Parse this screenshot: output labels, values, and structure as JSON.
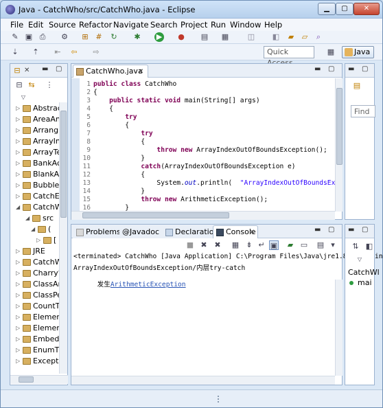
{
  "window": {
    "title": "Java - CatchWho/src/CatchWho.java - Eclipse"
  },
  "menu": [
    "File",
    "Edit",
    "Source",
    "Refactor",
    "Navigate",
    "Search",
    "Project",
    "Run",
    "Window",
    "Help"
  ],
  "toolbar": {
    "quick_access_placeholder": "Quick Access",
    "perspective_label": "Java"
  },
  "package_explorer": {
    "items": [
      {
        "label": "Abstrac",
        "arrow": "▷"
      },
      {
        "label": "AreaAn",
        "arrow": "▷"
      },
      {
        "label": "Arrang",
        "arrow": "▷"
      },
      {
        "label": "ArrayIn",
        "arrow": "▷"
      },
      {
        "label": "ArrayTe",
        "arrow": "▷"
      },
      {
        "label": "BankAc",
        "arrow": "▷"
      },
      {
        "label": "BlankA",
        "arrow": "▷"
      },
      {
        "label": "Bubble",
        "arrow": "▷"
      },
      {
        "label": "CatchE:",
        "arrow": "▷"
      },
      {
        "label": "CatchW",
        "arrow": "◢"
      },
      {
        "label": "src",
        "arrow": "◢"
      },
      {
        "label": "(",
        "arrow": "◢"
      },
      {
        "label": "[",
        "arrow": "▷"
      },
      {
        "label": "JRE",
        "arrow": "▷"
      },
      {
        "label": "CatchW",
        "arrow": "▷"
      },
      {
        "label": "Charry'",
        "arrow": "▷"
      },
      {
        "label": "ClassAr",
        "arrow": "▷"
      },
      {
        "label": "ClassPe",
        "arrow": "▷"
      },
      {
        "label": "CountT",
        "arrow": "▷"
      },
      {
        "label": "Elemen",
        "arrow": "▷"
      },
      {
        "label": "Elemen",
        "arrow": "▷"
      },
      {
        "label": "Embed",
        "arrow": "▷"
      },
      {
        "label": "EnumT",
        "arrow": "▷"
      },
      {
        "label": "Excepti",
        "arrow": "▷"
      }
    ]
  },
  "editor": {
    "tab_label": "CatchWho.java",
    "lines": [
      {
        "n": "1",
        "html": "<span class=\"kw\">public class</span> CatchWho"
      },
      {
        "n": "2",
        "html": "{"
      },
      {
        "n": "3",
        "html": "    <span class=\"kw\">public static void</span> main(String[] args)"
      },
      {
        "n": "4",
        "html": "    {"
      },
      {
        "n": "5",
        "html": "        <span class=\"kw\">try</span>"
      },
      {
        "n": "6",
        "html": "        {"
      },
      {
        "n": "7",
        "html": "            <span class=\"kw\">try</span>"
      },
      {
        "n": "8",
        "html": "            {"
      },
      {
        "n": "9",
        "html": "                <span class=\"kw\">throw new</span> ArrayIndexOutOfBoundsException();"
      },
      {
        "n": "10",
        "html": "            }"
      },
      {
        "n": "11",
        "html": "            <span class=\"kw\">catch</span>(ArrayIndexOutOfBoundsException e)"
      },
      {
        "n": "12",
        "html": "            {"
      },
      {
        "n": "13",
        "html": "                System.<span class=\"fld\">out</span>.println(  <span class=\"str\">\"ArrayIndexOutOfBoundsEx</span>"
      },
      {
        "n": "14",
        "html": "            }"
      },
      {
        "n": "15",
        "html": "            <span class=\"kw\">throw new</span> ArithmeticException();"
      },
      {
        "n": "16",
        "html": "        }"
      }
    ]
  },
  "views": {
    "problems": "Problems",
    "javadoc": "Javadoc",
    "declaration": "Declaration",
    "console": "Console"
  },
  "console": {
    "terminated": "<terminated> CatchWho [Java Application] C:\\Program Files\\Java\\jre1.8.0_60\\bin\\ja",
    "line1": "ArrayIndexOutOfBoundsException/内层try-catch",
    "line2_prefix": "发生",
    "line2_link": "ArithmeticException"
  },
  "right_panel": {
    "find": "Find",
    "outline_class": "CatchWl",
    "outline_member": "mai"
  }
}
